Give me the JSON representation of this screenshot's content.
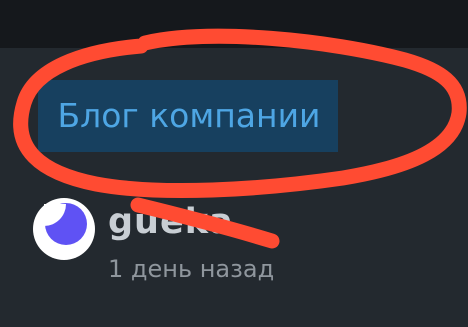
{
  "post": {
    "hub_badge": "Блог компании",
    "author": {
      "name": "gueka",
      "time": "1 день назад"
    }
  },
  "annotation": {
    "color": "#ff4b32",
    "description": "red hand-drawn circle around badge"
  },
  "colors": {
    "background": "#23292f",
    "topbar": "#15181c",
    "badge_bg": "#17405f",
    "badge_text": "#4ea6e4",
    "avatar_mark": "#5f52f4"
  }
}
